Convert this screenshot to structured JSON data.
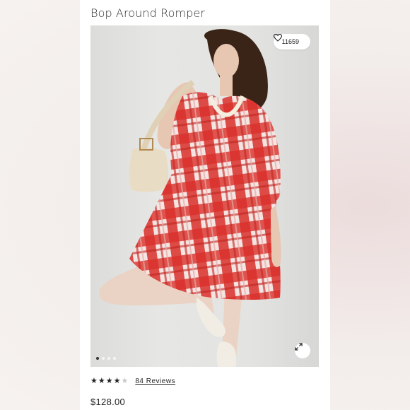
{
  "product": {
    "title": "Bop Around Romper",
    "likes": "11659",
    "rating": 4,
    "rating_max": 5,
    "reviews_label": "84 Reviews",
    "price": "$128.00"
  },
  "gallery": {
    "slides": 4,
    "active_slide": 1
  },
  "icons": {
    "like": "heart-outline-icon",
    "expand": "expand-arrows-icon",
    "star": "star-icon"
  },
  "colors": {
    "plaid_red": "#d9302a",
    "text": "#222222",
    "background": "#ffffff"
  }
}
